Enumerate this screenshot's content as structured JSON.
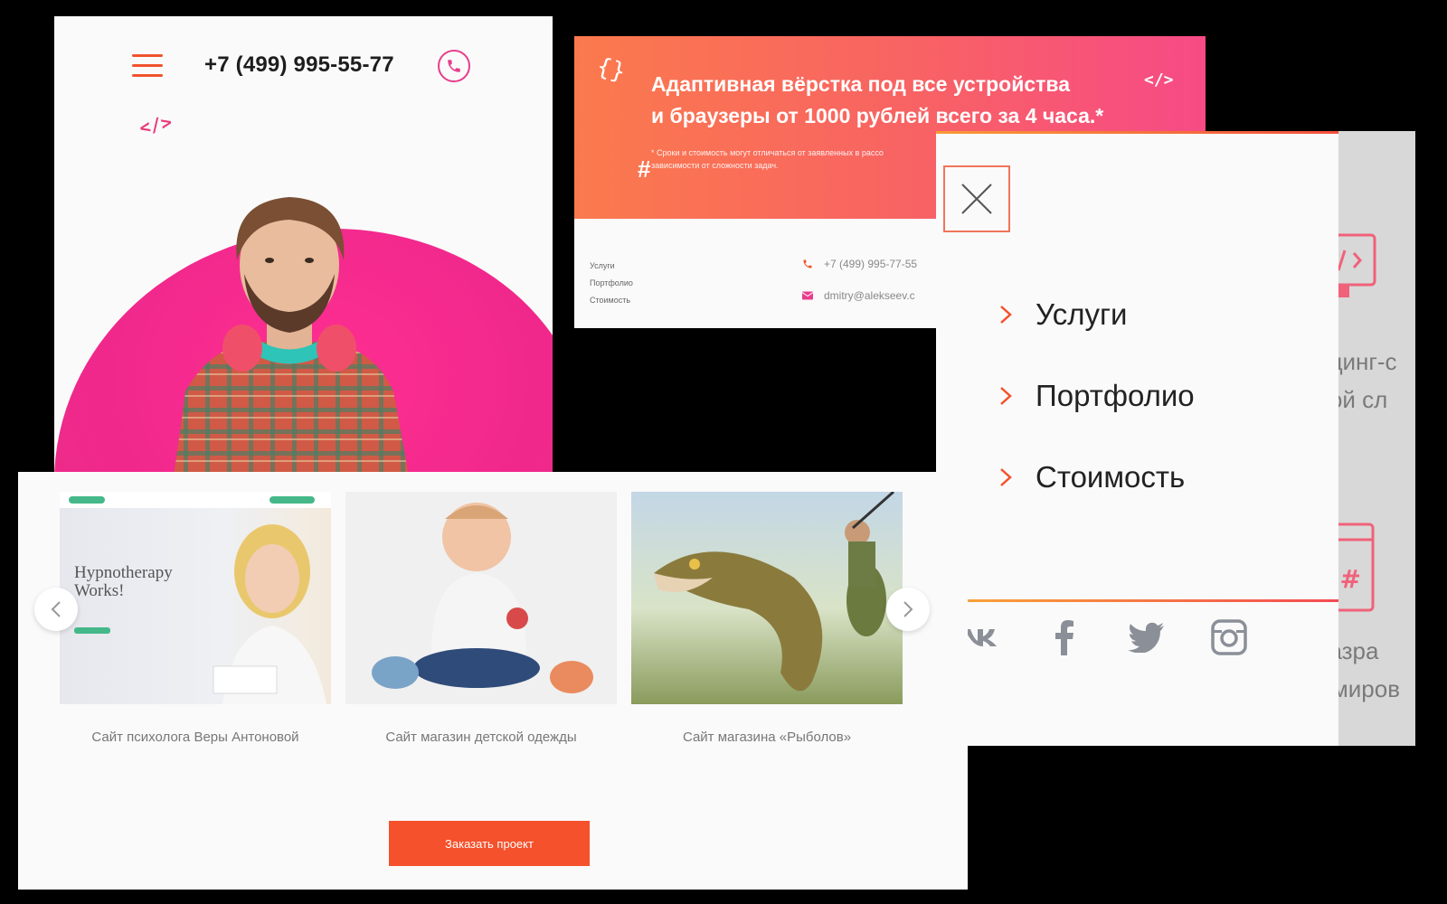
{
  "hero": {
    "phone": "+7 (499) 995-55-77",
    "code_mark": "</>"
  },
  "promo": {
    "title_line1": "Адаптивная вёрстка под все устройства",
    "title_line2": "и браузеры от 1000 рублей всего за 4 часа.*",
    "footnote_line1": "* Сроки и стоимость могут отличаться от заявленных в рассо",
    "footnote_line2": "зависимости от сложности задач.",
    "nav": [
      "Услуги",
      "Портфолио",
      "Стоимость"
    ],
    "contact_phone": "+7 (499) 995-77-55",
    "contact_email": "dmitry@alekseev.c"
  },
  "menu": {
    "items": [
      {
        "label": "Услуги"
      },
      {
        "label": "Портфолио"
      },
      {
        "label": "Стоимость"
      }
    ],
    "shade_text": [
      "ндинг-с",
      "бой сл",
      "разра",
      "ммиров"
    ],
    "social": [
      "vk-icon",
      "facebook-icon",
      "twitter-icon",
      "instagram-icon"
    ]
  },
  "portfolio": {
    "items": [
      {
        "caption": "Сайт психолога Веры Антоновой",
        "thumb_title": "Hypnotherapy Works!"
      },
      {
        "caption": "Сайт магазин детской одежды"
      },
      {
        "caption": "Сайт магазина «Рыболов»"
      }
    ],
    "order_button": "Заказать проект"
  },
  "colors": {
    "accent_orange": "#f4512c",
    "accent_pink": "#f0288c",
    "gradient_start": "#fb7a4d",
    "gradient_end": "#f74a86"
  }
}
